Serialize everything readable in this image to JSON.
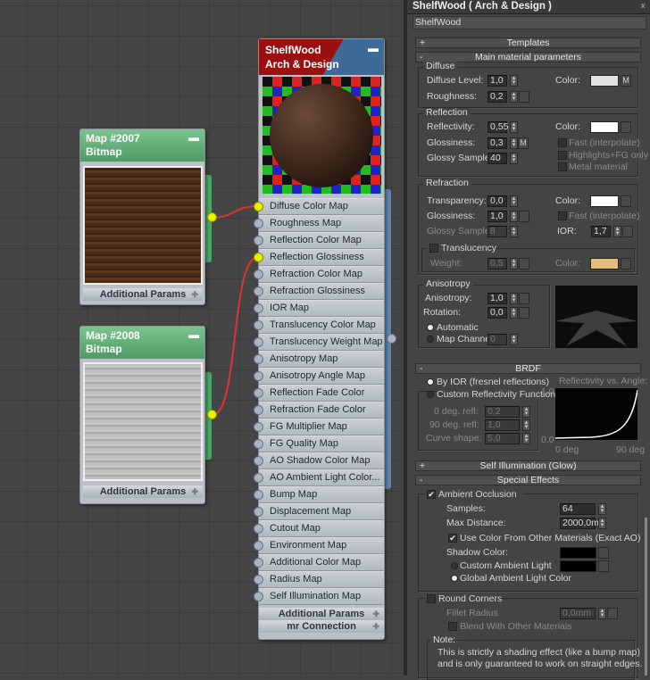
{
  "map_nodes": [
    {
      "title": "Map #2007",
      "type": "Bitmap",
      "footer": "Additional Params"
    },
    {
      "title": "Map #2008",
      "type": "Bitmap",
      "footer": "Additional Params"
    }
  ],
  "material_node": {
    "title_line1": "ShelfWood",
    "title_line2": "Arch & Design",
    "slots": [
      "Diffuse Color Map",
      "Roughness Map",
      "Reflection Color Map",
      "Reflection Glossiness Map",
      "Refraction Color Map",
      "Refraction Glossiness Map",
      "IOR Map",
      "Translucency Color Map",
      "Translucency Weight Map",
      "Anisotropy Map",
      "Anisotropy Angle Map",
      "Reflection Fade Color Map",
      "Refraction Fade Color Map",
      "FG Multiplier Map",
      "FG Quality Map",
      "AO Shadow Color Map",
      "AO Ambient Light Color...",
      "Bump Map",
      "Displacement Map",
      "Cutout Map",
      "Environment Map",
      "Additional Color Map",
      "Radius Map",
      "Self Illumination Map"
    ],
    "connected_slots": [
      0,
      3
    ],
    "footer1": "Additional Params",
    "footer2": "mr Connection"
  },
  "panel": {
    "title": "ShelfWood  ( Arch & Design )",
    "close": "x",
    "name_value": "ShelfWood",
    "rollouts": {
      "templates": "Templates",
      "main": "Main material parameters",
      "brdf": "BRDF",
      "self_illum": "Self Illumination (Glow)",
      "special": "Special Effects"
    },
    "diffuse": {
      "group": "Diffuse",
      "level_label": "Diffuse Level:",
      "level": "1,0",
      "roughness_label": "Roughness:",
      "roughness": "0,2",
      "color_label": "Color:",
      "color": "#e2e2e2",
      "map_btn": "M"
    },
    "reflection": {
      "group": "Reflection",
      "reflectivity_label": "Reflectivity:",
      "reflectivity": "0,55",
      "glossiness_label": "Glossiness:",
      "glossiness": "0,3",
      "map_btn": "M",
      "samples_label": "Glossy Samples:",
      "samples": "40",
      "color_label": "Color:",
      "color": "#ffffff",
      "fast": "Fast (interpolate)",
      "highlights": "Highlights+FG only",
      "metal": "Metal material"
    },
    "refraction": {
      "group": "Refraction",
      "transparency_label": "Transparency:",
      "transparency": "0,0",
      "glossiness_label": "Glossiness:",
      "glossiness": "1,0",
      "samples_label": "Glossy Samples:",
      "samples": "8",
      "color_label": "Color:",
      "color": "#ffffff",
      "fast": "Fast (interpolate)",
      "ior_label": "IOR:",
      "ior": "1,7",
      "translucency": "Translucency",
      "weight_label": "Weight:",
      "weight": "0,5",
      "tcolor_label": "Color:",
      "tcolor": "#e2c07f"
    },
    "anisotropy": {
      "group": "Anisotropy",
      "anisotropy_label": "Anisotropy:",
      "anisotropy": "1,0",
      "rotation_label": "Rotation:",
      "rotation": "0,0",
      "automatic": "Automatic",
      "map_channel": "Map Channel:",
      "channel": "0"
    },
    "brdf": {
      "by_ior": "By IOR (fresnel reflections)",
      "custom": "Custom Reflectivity Function",
      "deg0_label": "0 deg. refl:",
      "deg0": "0,2",
      "deg90_label": "90 deg. refl:",
      "deg90": "1,0",
      "curve_label": "Curve shape:",
      "curve": "5,0",
      "graph_title": "Reflectivity vs. Angle:",
      "y_max": "1.0",
      "y_min": "0.0",
      "x_min": "0 deg",
      "x_max": "90 deg"
    },
    "ao": {
      "label": "Ambient Occlusion",
      "enabled": true,
      "samples_label": "Samples:",
      "samples": "64",
      "distance_label": "Max Distance:",
      "distance": "2000,0mm",
      "use_color": "Use Color From Other Materials (Exact AO)",
      "shadow_label": "Shadow Color:",
      "custom_light": "Custom Ambient Light",
      "global_light": "Global Ambient Light Color"
    },
    "round": {
      "label": "Round Corners",
      "fillet_label": "Fillet Radius",
      "fillet": "0,0mm",
      "blend": "Blend With Other Materials",
      "note_title": "Note:",
      "note1": "This is strictly a shading effect (like a bump map)",
      "note2": "and is only guaranteed to work on straight edges."
    }
  }
}
